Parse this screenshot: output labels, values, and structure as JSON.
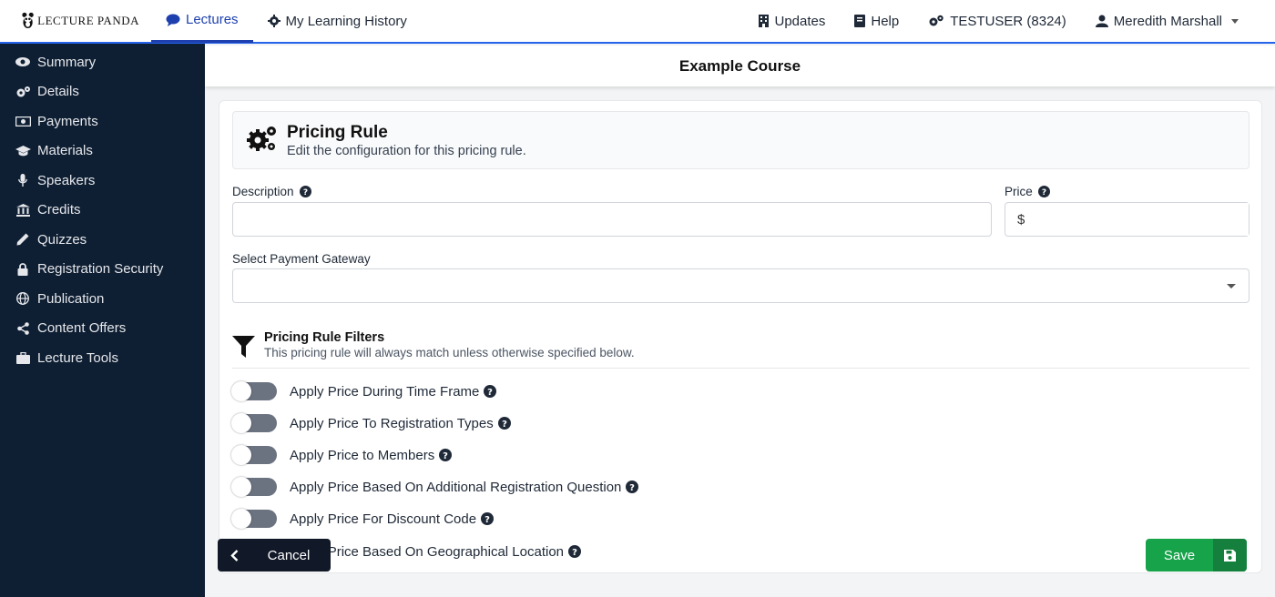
{
  "brand": {
    "logo_text": "LECTURE PANDA"
  },
  "topnav": {
    "left": [
      {
        "label": "Lectures",
        "icon": "comment-icon",
        "active": true
      },
      {
        "label": "My Learning History",
        "icon": "gear-icon"
      }
    ],
    "right": [
      {
        "label": "Updates",
        "icon": "building-icon"
      },
      {
        "label": "Help",
        "icon": "book-icon"
      },
      {
        "label": "TESTUSER (8324)",
        "icon": "cogs-icon"
      },
      {
        "label": "Meredith Marshall",
        "icon": "user-icon"
      }
    ]
  },
  "sidebar": {
    "items": [
      {
        "label": "Summary",
        "icon": "eye-icon"
      },
      {
        "label": "Details",
        "icon": "cogs-icon"
      },
      {
        "label": "Payments",
        "icon": "money-icon"
      },
      {
        "label": "Materials",
        "icon": "graduation-cap-icon"
      },
      {
        "label": "Speakers",
        "icon": "microphone-icon"
      },
      {
        "label": "Credits",
        "icon": "institution-icon"
      },
      {
        "label": "Quizzes",
        "icon": "pencil-icon"
      },
      {
        "label": "Registration Security",
        "icon": "lock-icon"
      },
      {
        "label": "Publication",
        "icon": "globe-icon"
      },
      {
        "label": "Content Offers",
        "icon": "share-icon"
      },
      {
        "label": "Lecture Tools",
        "icon": "briefcase-icon"
      }
    ]
  },
  "course": {
    "title": "Example Course"
  },
  "rule": {
    "title": "Pricing Rule",
    "subtitle": "Edit the configuration for this pricing rule."
  },
  "form": {
    "description_label": "Description",
    "description_value": "",
    "price_label": "Price",
    "price_symbol": "$",
    "price_value": "",
    "gateway_label": "Select Payment Gateway",
    "gateway_value": ""
  },
  "filters": {
    "title": "Pricing Rule Filters",
    "subtitle": "This pricing rule will always match unless otherwise specified below.",
    "items": [
      {
        "label": "Apply Price During Time Frame",
        "enabled": false
      },
      {
        "label": "Apply Price To Registration Types",
        "enabled": false
      },
      {
        "label": "Apply Price to Members",
        "enabled": false
      },
      {
        "label": "Apply Price Based On Additional Registration Question",
        "enabled": false
      },
      {
        "label": "Apply Price For Discount Code",
        "enabled": false
      },
      {
        "label": "Apply Price Based On Geographical Location",
        "enabled": false
      }
    ]
  },
  "actions": {
    "cancel_label": "Cancel",
    "save_label": "Save"
  },
  "colors": {
    "accent": "#1e40af",
    "sidebar": "#0f1f33",
    "save": "#16a34a",
    "cancel": "#111827"
  }
}
